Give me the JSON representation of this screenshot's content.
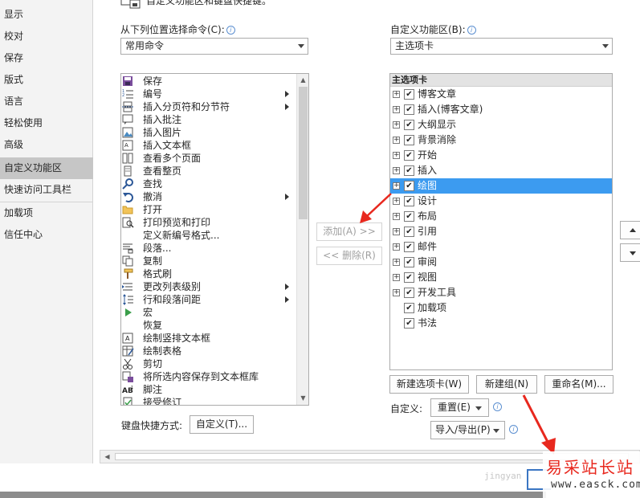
{
  "nav": {
    "items": [
      {
        "label": "显示",
        "active": false
      },
      {
        "label": "校对",
        "active": false
      },
      {
        "label": "保存",
        "active": false
      },
      {
        "label": "版式",
        "active": false
      },
      {
        "label": "语言",
        "active": false
      },
      {
        "label": "轻松使用",
        "active": false
      },
      {
        "label": "高级",
        "active": false
      },
      {
        "label": "自定义功能区",
        "active": true
      },
      {
        "label": "快速访问工具栏",
        "active": false
      },
      {
        "label": "加载项",
        "active": false
      },
      {
        "label": "信任中心",
        "active": false
      }
    ]
  },
  "header": {
    "text": "自定义功能区和键盘快捷键。"
  },
  "left_panel": {
    "label": "从下列位置选择命令(C):",
    "dropdown_value": "常用命令",
    "commands": [
      {
        "label": "保存",
        "icon": "save-icon",
        "submenu": false
      },
      {
        "label": "编号",
        "icon": "numbering-icon",
        "submenu": true
      },
      {
        "label": "插入分页符和分节符",
        "icon": "page-break-icon",
        "submenu": true
      },
      {
        "label": "插入批注",
        "icon": "comment-icon",
        "submenu": false
      },
      {
        "label": "插入图片",
        "icon": "picture-icon",
        "submenu": false
      },
      {
        "label": "插入文本框",
        "icon": "textbox-icon",
        "submenu": false
      },
      {
        "label": "查看多个页面",
        "icon": "multipage-icon",
        "submenu": false
      },
      {
        "label": "查看整页",
        "icon": "onepage-icon",
        "submenu": false
      },
      {
        "label": "查找",
        "icon": "find-icon",
        "submenu": false
      },
      {
        "label": "撤消",
        "icon": "undo-icon",
        "submenu": true
      },
      {
        "label": "打开",
        "icon": "open-folder-icon",
        "submenu": false
      },
      {
        "label": "打印预览和打印",
        "icon": "print-preview-icon",
        "submenu": false
      },
      {
        "label": "定义新编号格式...",
        "icon": "",
        "submenu": false
      },
      {
        "label": "段落...",
        "icon": "paragraph-icon",
        "submenu": false
      },
      {
        "label": "复制",
        "icon": "copy-icon",
        "submenu": false
      },
      {
        "label": "格式刷",
        "icon": "format-painter-icon",
        "submenu": false
      },
      {
        "label": "更改列表级别",
        "icon": "list-level-icon",
        "submenu": true
      },
      {
        "label": "行和段落间距",
        "icon": "line-spacing-icon",
        "submenu": true
      },
      {
        "label": "宏",
        "icon": "macro-icon",
        "submenu": false
      },
      {
        "label": "恢复",
        "icon": "",
        "submenu": false
      },
      {
        "label": "绘制竖排文本框",
        "icon": "vertical-textbox-icon",
        "submenu": false
      },
      {
        "label": "绘制表格",
        "icon": "draw-table-icon",
        "submenu": false
      },
      {
        "label": "剪切",
        "icon": "cut-icon",
        "submenu": false
      },
      {
        "label": "将所选内容保存到文本框库",
        "icon": "save-selection-icon",
        "submenu": false
      },
      {
        "label": "脚注",
        "icon": "footnote-icon",
        "submenu": false
      },
      {
        "label": "接受修订",
        "icon": "accept-change-icon",
        "submenu": false
      }
    ],
    "keyboard_label": "键盘快捷方式:",
    "keyboard_button": "自定义(T)..."
  },
  "middle": {
    "add_button": "添加(A) >>",
    "remove_button": "<< 删除(R)"
  },
  "right_panel": {
    "label": "自定义功能区(B):",
    "dropdown_value": "主选项卡",
    "tree_header": "主选项卡",
    "tabs": [
      {
        "label": "博客文章",
        "expandable": true,
        "checked": true,
        "selected": false
      },
      {
        "label": "插入(博客文章)",
        "expandable": true,
        "checked": true,
        "selected": false
      },
      {
        "label": "大纲显示",
        "expandable": true,
        "checked": true,
        "selected": false
      },
      {
        "label": "背景消除",
        "expandable": true,
        "checked": true,
        "selected": false
      },
      {
        "label": "开始",
        "expandable": true,
        "checked": true,
        "selected": false
      },
      {
        "label": "插入",
        "expandable": true,
        "checked": true,
        "selected": false
      },
      {
        "label": "绘图",
        "expandable": true,
        "checked": true,
        "selected": true
      },
      {
        "label": "设计",
        "expandable": true,
        "checked": true,
        "selected": false
      },
      {
        "label": "布局",
        "expandable": true,
        "checked": true,
        "selected": false
      },
      {
        "label": "引用",
        "expandable": true,
        "checked": true,
        "selected": false
      },
      {
        "label": "邮件",
        "expandable": true,
        "checked": true,
        "selected": false
      },
      {
        "label": "审阅",
        "expandable": true,
        "checked": true,
        "selected": false
      },
      {
        "label": "视图",
        "expandable": true,
        "checked": true,
        "selected": false
      },
      {
        "label": "开发工具",
        "expandable": true,
        "checked": true,
        "selected": false
      },
      {
        "label": "加载项",
        "expandable": false,
        "checked": true,
        "selected": false
      },
      {
        "label": "书法",
        "expandable": false,
        "checked": true,
        "selected": false
      }
    ],
    "new_tab_button": "新建选项卡(W)",
    "new_group_button": "新建组(N)",
    "rename_button": "重命名(M)...",
    "customize_label": "自定义:",
    "reset_button": "重置(E)",
    "import_export_button": "导入/导出(P)"
  },
  "watermark": {
    "brand": "易采站长站",
    "url": "www.easck.com",
    "corner": "jingyan"
  },
  "colors": {
    "selection": "#3c9bf0",
    "nav_active": "#c6c6c6",
    "annotation_arrow": "#e8281e"
  }
}
